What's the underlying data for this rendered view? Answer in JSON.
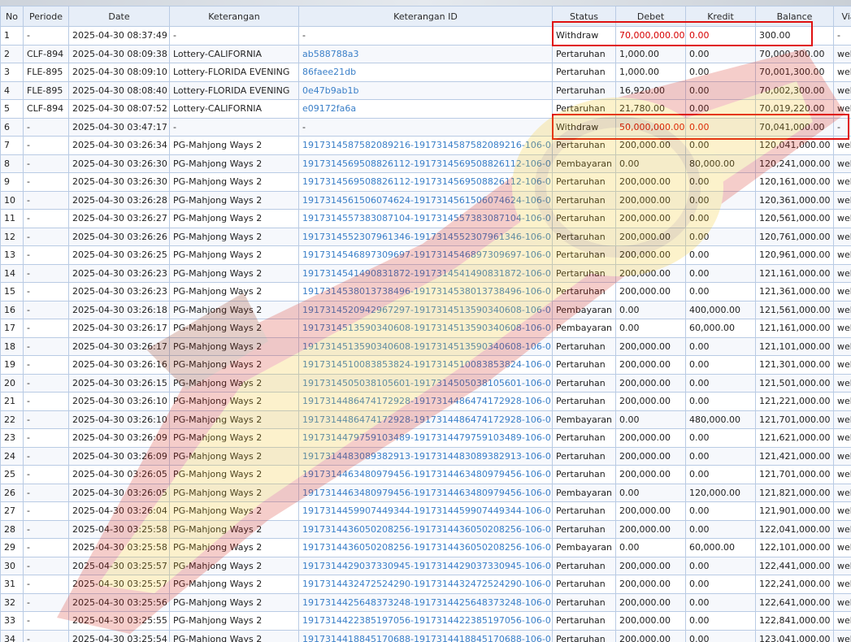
{
  "table": {
    "headers": [
      "No",
      "Periode",
      "Date",
      "Keterangan",
      "Keterangan ID",
      "Status",
      "Debet",
      "Kredit",
      "Balance",
      "Via"
    ],
    "rows": [
      {
        "no": "1",
        "periode": "-",
        "date": "2025-04-30 08:37:49",
        "keterangan": "-",
        "ket_id": "-",
        "status": "Withdraw",
        "debet": "70,000,000.00",
        "kredit": "0.00",
        "balance": "300.00",
        "via": "-",
        "highlight": true,
        "id_link": false
      },
      {
        "no": "2",
        "periode": "CLF-894",
        "date": "2025-04-30 08:09:38",
        "keterangan": "Lottery-CALIFORNIA",
        "ket_id": "ab588788a3",
        "status": "Pertaruhan",
        "debet": "1,000.00",
        "kredit": "0.00",
        "balance": "70,000,300.00",
        "via": "web",
        "highlight": false,
        "id_link": true
      },
      {
        "no": "3",
        "periode": "FLE-895",
        "date": "2025-04-30 08:09:10",
        "keterangan": "Lottery-FLORIDA EVENING",
        "ket_id": "86faee21db",
        "status": "Pertaruhan",
        "debet": "1,000.00",
        "kredit": "0.00",
        "balance": "70,001,300.00",
        "via": "web",
        "highlight": false,
        "id_link": true
      },
      {
        "no": "4",
        "periode": "FLE-895",
        "date": "2025-04-30 08:08:40",
        "keterangan": "Lottery-FLORIDA EVENING",
        "ket_id": "0e47b9ab1b",
        "status": "Pertaruhan",
        "debet": "16,920.00",
        "kredit": "0.00",
        "balance": "70,002,300.00",
        "via": "web",
        "highlight": false,
        "id_link": true
      },
      {
        "no": "5",
        "periode": "CLF-894",
        "date": "2025-04-30 08:07:52",
        "keterangan": "Lottery-CALIFORNIA",
        "ket_id": "e09172fa6a",
        "status": "Pertaruhan",
        "debet": "21,780.00",
        "kredit": "0.00",
        "balance": "70,019,220.00",
        "via": "web",
        "highlight": false,
        "id_link": true
      },
      {
        "no": "6",
        "periode": "-",
        "date": "2025-04-30 03:47:17",
        "keterangan": "-",
        "ket_id": "-",
        "status": "Withdraw",
        "debet": "50,000,000.00",
        "kredit": "0.00",
        "balance": "70,041,000.00",
        "via": "-",
        "highlight": true,
        "id_link": false
      },
      {
        "no": "7",
        "periode": "-",
        "date": "2025-04-30 03:26:34",
        "keterangan": "PG-Mahjong Ways 2",
        "ket_id": "1917314587582089216-1917314587582089216-106-0",
        "status": "Pertaruhan",
        "debet": "200,000.00",
        "kredit": "0.00",
        "balance": "120,041,000.00",
        "via": "web",
        "highlight": false,
        "id_link": true
      },
      {
        "no": "8",
        "periode": "-",
        "date": "2025-04-30 03:26:30",
        "keterangan": "PG-Mahjong Ways 2",
        "ket_id": "1917314569508826112-1917314569508826112-106-0",
        "status": "Pembayaran",
        "debet": "0.00",
        "kredit": "80,000.00",
        "balance": "120,241,000.00",
        "via": "web",
        "highlight": false,
        "id_link": true
      },
      {
        "no": "9",
        "periode": "-",
        "date": "2025-04-30 03:26:30",
        "keterangan": "PG-Mahjong Ways 2",
        "ket_id": "1917314569508826112-1917314569508826112-106-0",
        "status": "Pertaruhan",
        "debet": "200,000.00",
        "kredit": "0.00",
        "balance": "120,161,000.00",
        "via": "web",
        "highlight": false,
        "id_link": true
      },
      {
        "no": "10",
        "periode": "-",
        "date": "2025-04-30 03:26:28",
        "keterangan": "PG-Mahjong Ways 2",
        "ket_id": "1917314561506074624-1917314561506074624-106-0",
        "status": "Pertaruhan",
        "debet": "200,000.00",
        "kredit": "0.00",
        "balance": "120,361,000.00",
        "via": "web",
        "highlight": false,
        "id_link": true
      },
      {
        "no": "11",
        "periode": "-",
        "date": "2025-04-30 03:26:27",
        "keterangan": "PG-Mahjong Ways 2",
        "ket_id": "1917314557383087104-1917314557383087104-106-0",
        "status": "Pertaruhan",
        "debet": "200,000.00",
        "kredit": "0.00",
        "balance": "120,561,000.00",
        "via": "web",
        "highlight": false,
        "id_link": true
      },
      {
        "no": "12",
        "periode": "-",
        "date": "2025-04-30 03:26:26",
        "keterangan": "PG-Mahjong Ways 2",
        "ket_id": "1917314552307961346-1917314552307961346-106-0",
        "status": "Pertaruhan",
        "debet": "200,000.00",
        "kredit": "0.00",
        "balance": "120,761,000.00",
        "via": "web",
        "highlight": false,
        "id_link": true
      },
      {
        "no": "13",
        "periode": "-",
        "date": "2025-04-30 03:26:25",
        "keterangan": "PG-Mahjong Ways 2",
        "ket_id": "1917314546897309697-1917314546897309697-106-0",
        "status": "Pertaruhan",
        "debet": "200,000.00",
        "kredit": "0.00",
        "balance": "120,961,000.00",
        "via": "web",
        "highlight": false,
        "id_link": true
      },
      {
        "no": "14",
        "periode": "-",
        "date": "2025-04-30 03:26:23",
        "keterangan": "PG-Mahjong Ways 2",
        "ket_id": "1917314541490831872-1917314541490831872-106-0",
        "status": "Pertaruhan",
        "debet": "200,000.00",
        "kredit": "0.00",
        "balance": "121,161,000.00",
        "via": "web",
        "highlight": false,
        "id_link": true
      },
      {
        "no": "15",
        "periode": "-",
        "date": "2025-04-30 03:26:23",
        "keterangan": "PG-Mahjong Ways 2",
        "ket_id": "1917314538013738496-1917314538013738496-106-0",
        "status": "Pertaruhan",
        "debet": "200,000.00",
        "kredit": "0.00",
        "balance": "121,361,000.00",
        "via": "web",
        "highlight": false,
        "id_link": true
      },
      {
        "no": "16",
        "periode": "-",
        "date": "2025-04-30 03:26:18",
        "keterangan": "PG-Mahjong Ways 2",
        "ket_id": "1917314520942967297-1917314513590340608-106-0",
        "status": "Pembayaran",
        "debet": "0.00",
        "kredit": "400,000.00",
        "balance": "121,561,000.00",
        "via": "web",
        "highlight": false,
        "id_link": true
      },
      {
        "no": "17",
        "periode": "-",
        "date": "2025-04-30 03:26:17",
        "keterangan": "PG-Mahjong Ways 2",
        "ket_id": "1917314513590340608-1917314513590340608-106-0",
        "status": "Pembayaran",
        "debet": "0.00",
        "kredit": "60,000.00",
        "balance": "121,161,000.00",
        "via": "web",
        "highlight": false,
        "id_link": true
      },
      {
        "no": "18",
        "periode": "-",
        "date": "2025-04-30 03:26:17",
        "keterangan": "PG-Mahjong Ways 2",
        "ket_id": "1917314513590340608-1917314513590340608-106-0",
        "status": "Pertaruhan",
        "debet": "200,000.00",
        "kredit": "0.00",
        "balance": "121,101,000.00",
        "via": "web",
        "highlight": false,
        "id_link": true
      },
      {
        "no": "19",
        "periode": "-",
        "date": "2025-04-30 03:26:16",
        "keterangan": "PG-Mahjong Ways 2",
        "ket_id": "1917314510083853824-1917314510083853824-106-0",
        "status": "Pertaruhan",
        "debet": "200,000.00",
        "kredit": "0.00",
        "balance": "121,301,000.00",
        "via": "web",
        "highlight": false,
        "id_link": true
      },
      {
        "no": "20",
        "periode": "-",
        "date": "2025-04-30 03:26:15",
        "keterangan": "PG-Mahjong Ways 2",
        "ket_id": "1917314505038105601-1917314505038105601-106-0",
        "status": "Pertaruhan",
        "debet": "200,000.00",
        "kredit": "0.00",
        "balance": "121,501,000.00",
        "via": "web",
        "highlight": false,
        "id_link": true
      },
      {
        "no": "21",
        "periode": "-",
        "date": "2025-04-30 03:26:10",
        "keterangan": "PG-Mahjong Ways 2",
        "ket_id": "1917314486474172928-1917314486474172928-106-0",
        "status": "Pertaruhan",
        "debet": "200,000.00",
        "kredit": "0.00",
        "balance": "121,221,000.00",
        "via": "web",
        "highlight": false,
        "id_link": true
      },
      {
        "no": "22",
        "periode": "-",
        "date": "2025-04-30 03:26:10",
        "keterangan": "PG-Mahjong Ways 2",
        "ket_id": "1917314486474172928-1917314486474172928-106-0",
        "status": "Pembayaran",
        "debet": "0.00",
        "kredit": "480,000.00",
        "balance": "121,701,000.00",
        "via": "web",
        "highlight": false,
        "id_link": true
      },
      {
        "no": "23",
        "periode": "-",
        "date": "2025-04-30 03:26:09",
        "keterangan": "PG-Mahjong Ways 2",
        "ket_id": "1917314479759103489-1917314479759103489-106-0",
        "status": "Pertaruhan",
        "debet": "200,000.00",
        "kredit": "0.00",
        "balance": "121,621,000.00",
        "via": "web",
        "highlight": false,
        "id_link": true
      },
      {
        "no": "24",
        "periode": "-",
        "date": "2025-04-30 03:26:09",
        "keterangan": "PG-Mahjong Ways 2",
        "ket_id": "1917314483089382913-1917314483089382913-106-0",
        "status": "Pertaruhan",
        "debet": "200,000.00",
        "kredit": "0.00",
        "balance": "121,421,000.00",
        "via": "web",
        "highlight": false,
        "id_link": true
      },
      {
        "no": "25",
        "periode": "-",
        "date": "2025-04-30 03:26:05",
        "keterangan": "PG-Mahjong Ways 2",
        "ket_id": "1917314463480979456-1917314463480979456-106-0",
        "status": "Pertaruhan",
        "debet": "200,000.00",
        "kredit": "0.00",
        "balance": "121,701,000.00",
        "via": "web",
        "highlight": false,
        "id_link": true
      },
      {
        "no": "26",
        "periode": "-",
        "date": "2025-04-30 03:26:05",
        "keterangan": "PG-Mahjong Ways 2",
        "ket_id": "1917314463480979456-1917314463480979456-106-0",
        "status": "Pembayaran",
        "debet": "0.00",
        "kredit": "120,000.00",
        "balance": "121,821,000.00",
        "via": "web",
        "highlight": false,
        "id_link": true
      },
      {
        "no": "27",
        "periode": "-",
        "date": "2025-04-30 03:26:04",
        "keterangan": "PG-Mahjong Ways 2",
        "ket_id": "1917314459907449344-1917314459907449344-106-0",
        "status": "Pertaruhan",
        "debet": "200,000.00",
        "kredit": "0.00",
        "balance": "121,901,000.00",
        "via": "web",
        "highlight": false,
        "id_link": true
      },
      {
        "no": "28",
        "periode": "-",
        "date": "2025-04-30 03:25:58",
        "keterangan": "PG-Mahjong Ways 2",
        "ket_id": "1917314436050208256-1917314436050208256-106-0",
        "status": "Pertaruhan",
        "debet": "200,000.00",
        "kredit": "0.00",
        "balance": "122,041,000.00",
        "via": "web",
        "highlight": false,
        "id_link": true
      },
      {
        "no": "29",
        "periode": "-",
        "date": "2025-04-30 03:25:58",
        "keterangan": "PG-Mahjong Ways 2",
        "ket_id": "1917314436050208256-1917314436050208256-106-0",
        "status": "Pembayaran",
        "debet": "0.00",
        "kredit": "60,000.00",
        "balance": "122,101,000.00",
        "via": "web",
        "highlight": false,
        "id_link": true
      },
      {
        "no": "30",
        "periode": "-",
        "date": "2025-04-30 03:25:57",
        "keterangan": "PG-Mahjong Ways 2",
        "ket_id": "1917314429037330945-1917314429037330945-106-0",
        "status": "Pertaruhan",
        "debet": "200,000.00",
        "kredit": "0.00",
        "balance": "122,441,000.00",
        "via": "web",
        "highlight": false,
        "id_link": true
      },
      {
        "no": "31",
        "periode": "-",
        "date": "2025-04-30 03:25:57",
        "keterangan": "PG-Mahjong Ways 2",
        "ket_id": "1917314432472524290-1917314432472524290-106-0",
        "status": "Pertaruhan",
        "debet": "200,000.00",
        "kredit": "0.00",
        "balance": "122,241,000.00",
        "via": "web",
        "highlight": false,
        "id_link": true
      },
      {
        "no": "32",
        "periode": "-",
        "date": "2025-04-30 03:25:56",
        "keterangan": "PG-Mahjong Ways 2",
        "ket_id": "1917314425648373248-1917314425648373248-106-0",
        "status": "Pertaruhan",
        "debet": "200,000.00",
        "kredit": "0.00",
        "balance": "122,641,000.00",
        "via": "web",
        "highlight": false,
        "id_link": true
      },
      {
        "no": "33",
        "periode": "-",
        "date": "2025-04-30 03:25:55",
        "keterangan": "PG-Mahjong Ways 2",
        "ket_id": "1917314422385197056-1917314422385197056-106-0",
        "status": "Pertaruhan",
        "debet": "200,000.00",
        "kredit": "0.00",
        "balance": "122,841,000.00",
        "via": "web",
        "highlight": false,
        "id_link": true
      },
      {
        "no": "34",
        "periode": "-",
        "date": "2025-04-30 03:25:54",
        "keterangan": "PG-Mahjong Ways 2",
        "ket_id": "1917314418845170688-1917314418845170688-106-0",
        "status": "Pertaruhan",
        "debet": "200,000.00",
        "kredit": "0.00",
        "balance": "123,041,000.00",
        "via": "web",
        "highlight": false,
        "id_link": true
      }
    ]
  },
  "colors": {
    "header_bg": "#e7eef8",
    "border": "#b9cbe4",
    "link": "#3a7fc8",
    "withdraw_red": "#d60000",
    "highlight_box": "#e01010"
  }
}
